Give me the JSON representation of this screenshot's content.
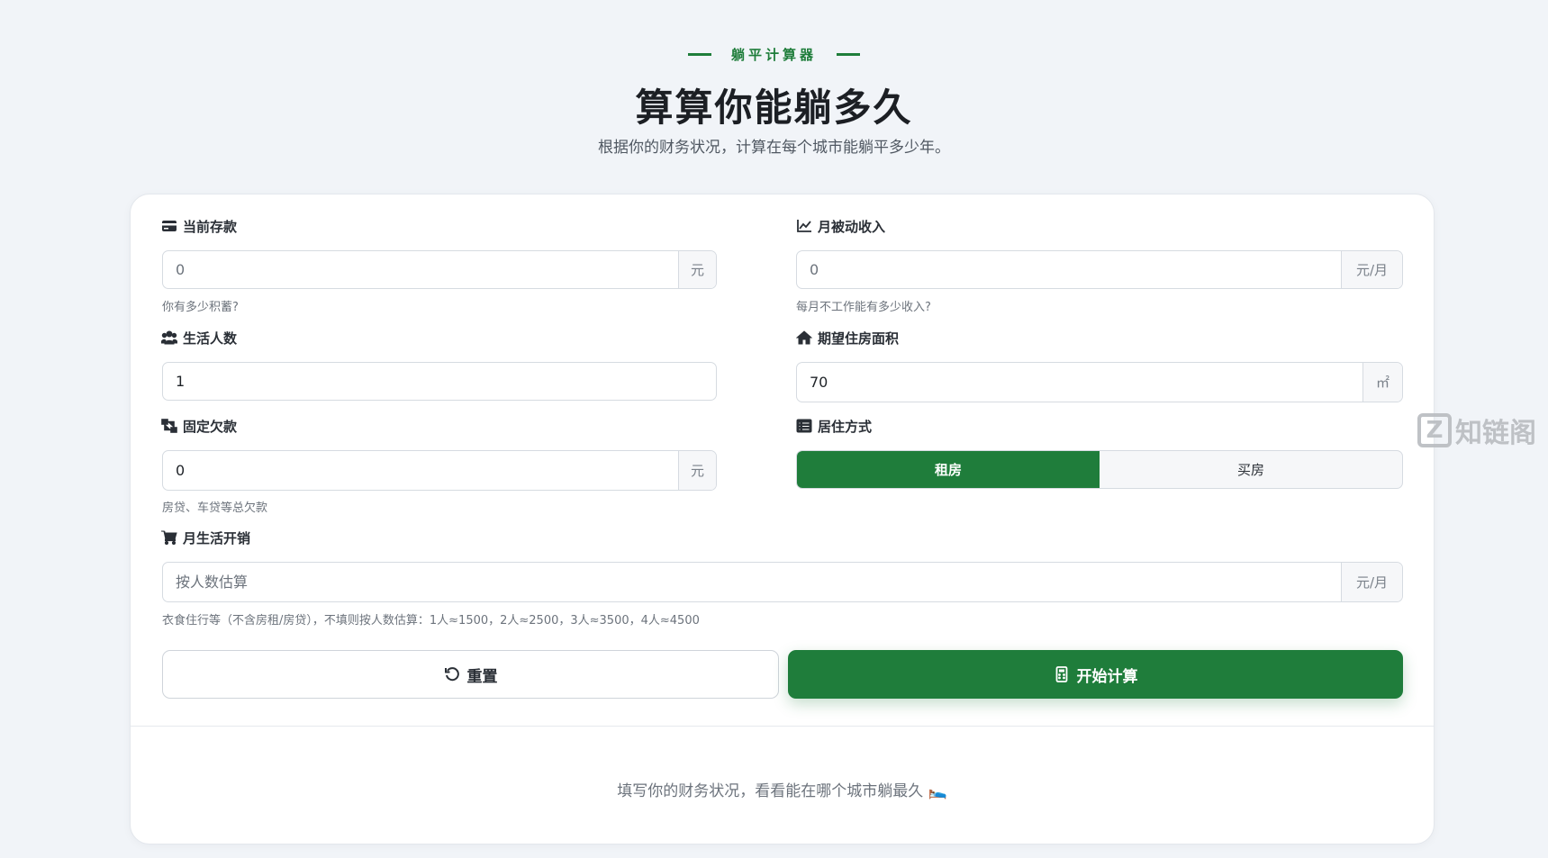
{
  "header": {
    "eyebrow": "躺平计算器",
    "title": "算算你能躺多久",
    "subtitle": "根据你的财务状况，计算在每个城市能躺平多少年。"
  },
  "form": {
    "savings": {
      "label": "当前存款",
      "placeholder": "0",
      "unit": "元",
      "hint": "你有多少积蓄?",
      "icon": "credit-card-icon"
    },
    "passive_income": {
      "label": "月被动收入",
      "placeholder": "0",
      "unit": "元/月",
      "hint": "每月不工作能有多少收入?",
      "icon": "chart-line-icon"
    },
    "people": {
      "label": "生活人数",
      "value": "1",
      "icon": "users-icon"
    },
    "area": {
      "label": "期望住房面积",
      "value": "70",
      "unit": "㎡",
      "icon": "home-icon"
    },
    "debt": {
      "label": "固定欠款",
      "value": "0",
      "unit": "元",
      "hint": "房贷、车贷等总欠款",
      "icon": "sitemap-icon"
    },
    "housing": {
      "label": "居住方式",
      "options": [
        "租房",
        "买房"
      ],
      "selected": "租房",
      "icon": "list-icon"
    },
    "expense": {
      "label": "月生活开销",
      "placeholder": "按人数估算",
      "unit": "元/月",
      "hint": "衣食住行等（不含房租/房贷），不填则按人数估算：1人≈1500，2人≈2500，3人≈3500，4人≈4500",
      "icon": "cart-icon"
    }
  },
  "buttons": {
    "reset": "重置",
    "calculate": "开始计算"
  },
  "result": {
    "placeholder": "填写你的财务状况，看看能在哪个城市躺最久 🛌"
  },
  "watermark": {
    "text": "知链阁",
    "letter": "Z"
  },
  "colors": {
    "accent": "#1f7d3b",
    "background": "#f1f4f8"
  }
}
